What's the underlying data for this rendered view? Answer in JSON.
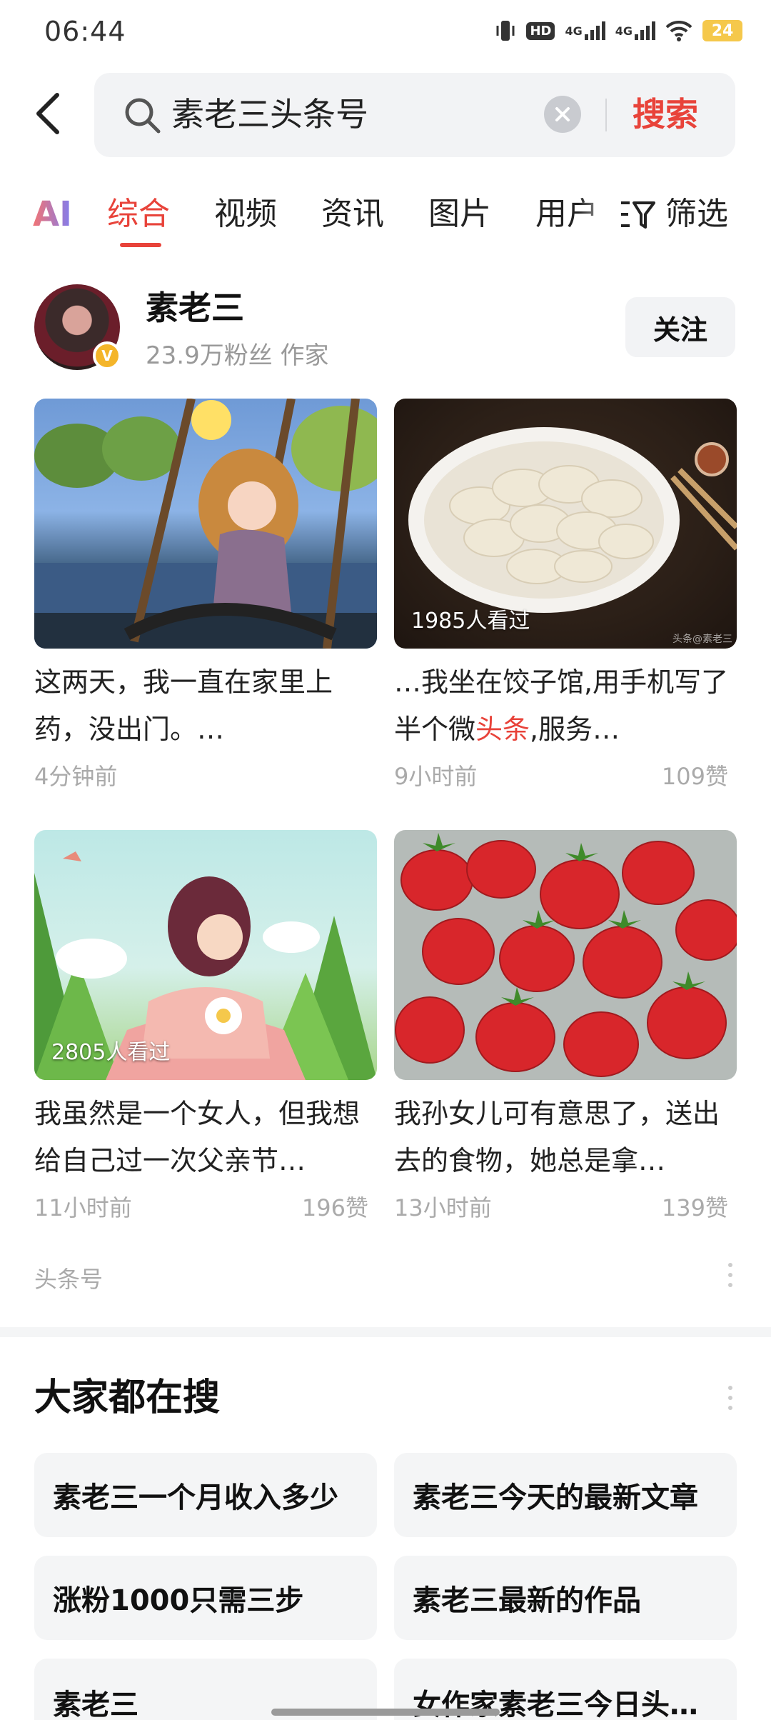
{
  "status": {
    "time": "06:44",
    "battery": "24",
    "hd": "HD",
    "net1": "4G",
    "net2": "4G"
  },
  "search": {
    "query": "素老三头条号",
    "submit_label": "搜索"
  },
  "tabs": [
    "AI",
    "综合",
    "视频",
    "资讯",
    "图片",
    "用户"
  ],
  "active_tab": "综合",
  "filter_label": "筛选",
  "profile": {
    "name": "素老三",
    "meta": "23.9万粉丝 作家",
    "verified_mark": "V",
    "follow_label": "关注"
  },
  "cards": [
    {
      "title": "这两天，我一直在家里上药，没出门。…",
      "time": "4分钟前",
      "views": "",
      "likes": ""
    },
    {
      "title_prefix": "…我坐在饺子馆,用手机写了半个微",
      "title_highlight": "头条",
      "title_suffix": ",服务…",
      "time": "9小时前",
      "views": "1985人看过",
      "likes": "109赞",
      "watermark": "头条@素老三"
    },
    {
      "title": "我虽然是一个女人，但我想给自己过一次父亲节…",
      "time": "11小时前",
      "views": "2805人看过",
      "likes": "196赞"
    },
    {
      "title": "我孙女儿可有意思了，送出去的食物，她总是拿…",
      "time": "13小时前",
      "views": "",
      "likes": "139赞"
    }
  ],
  "source_label": "头条号",
  "trending": {
    "title": "大家都在搜",
    "items": [
      "素老三一个月收入多少",
      "素老三今天的最新文章",
      "涨粉1000只需三步",
      "素老三最新的作品",
      "素老三",
      "女作家素老三今日头…"
    ]
  },
  "colors": {
    "accent": "#e8433a",
    "chip_bg": "#f4f5f6",
    "muted": "#aaaaaa"
  },
  "icons": [
    "back-arrow-icon",
    "search-icon",
    "clear-icon",
    "filter-icon",
    "verified-icon",
    "more-icon"
  ]
}
